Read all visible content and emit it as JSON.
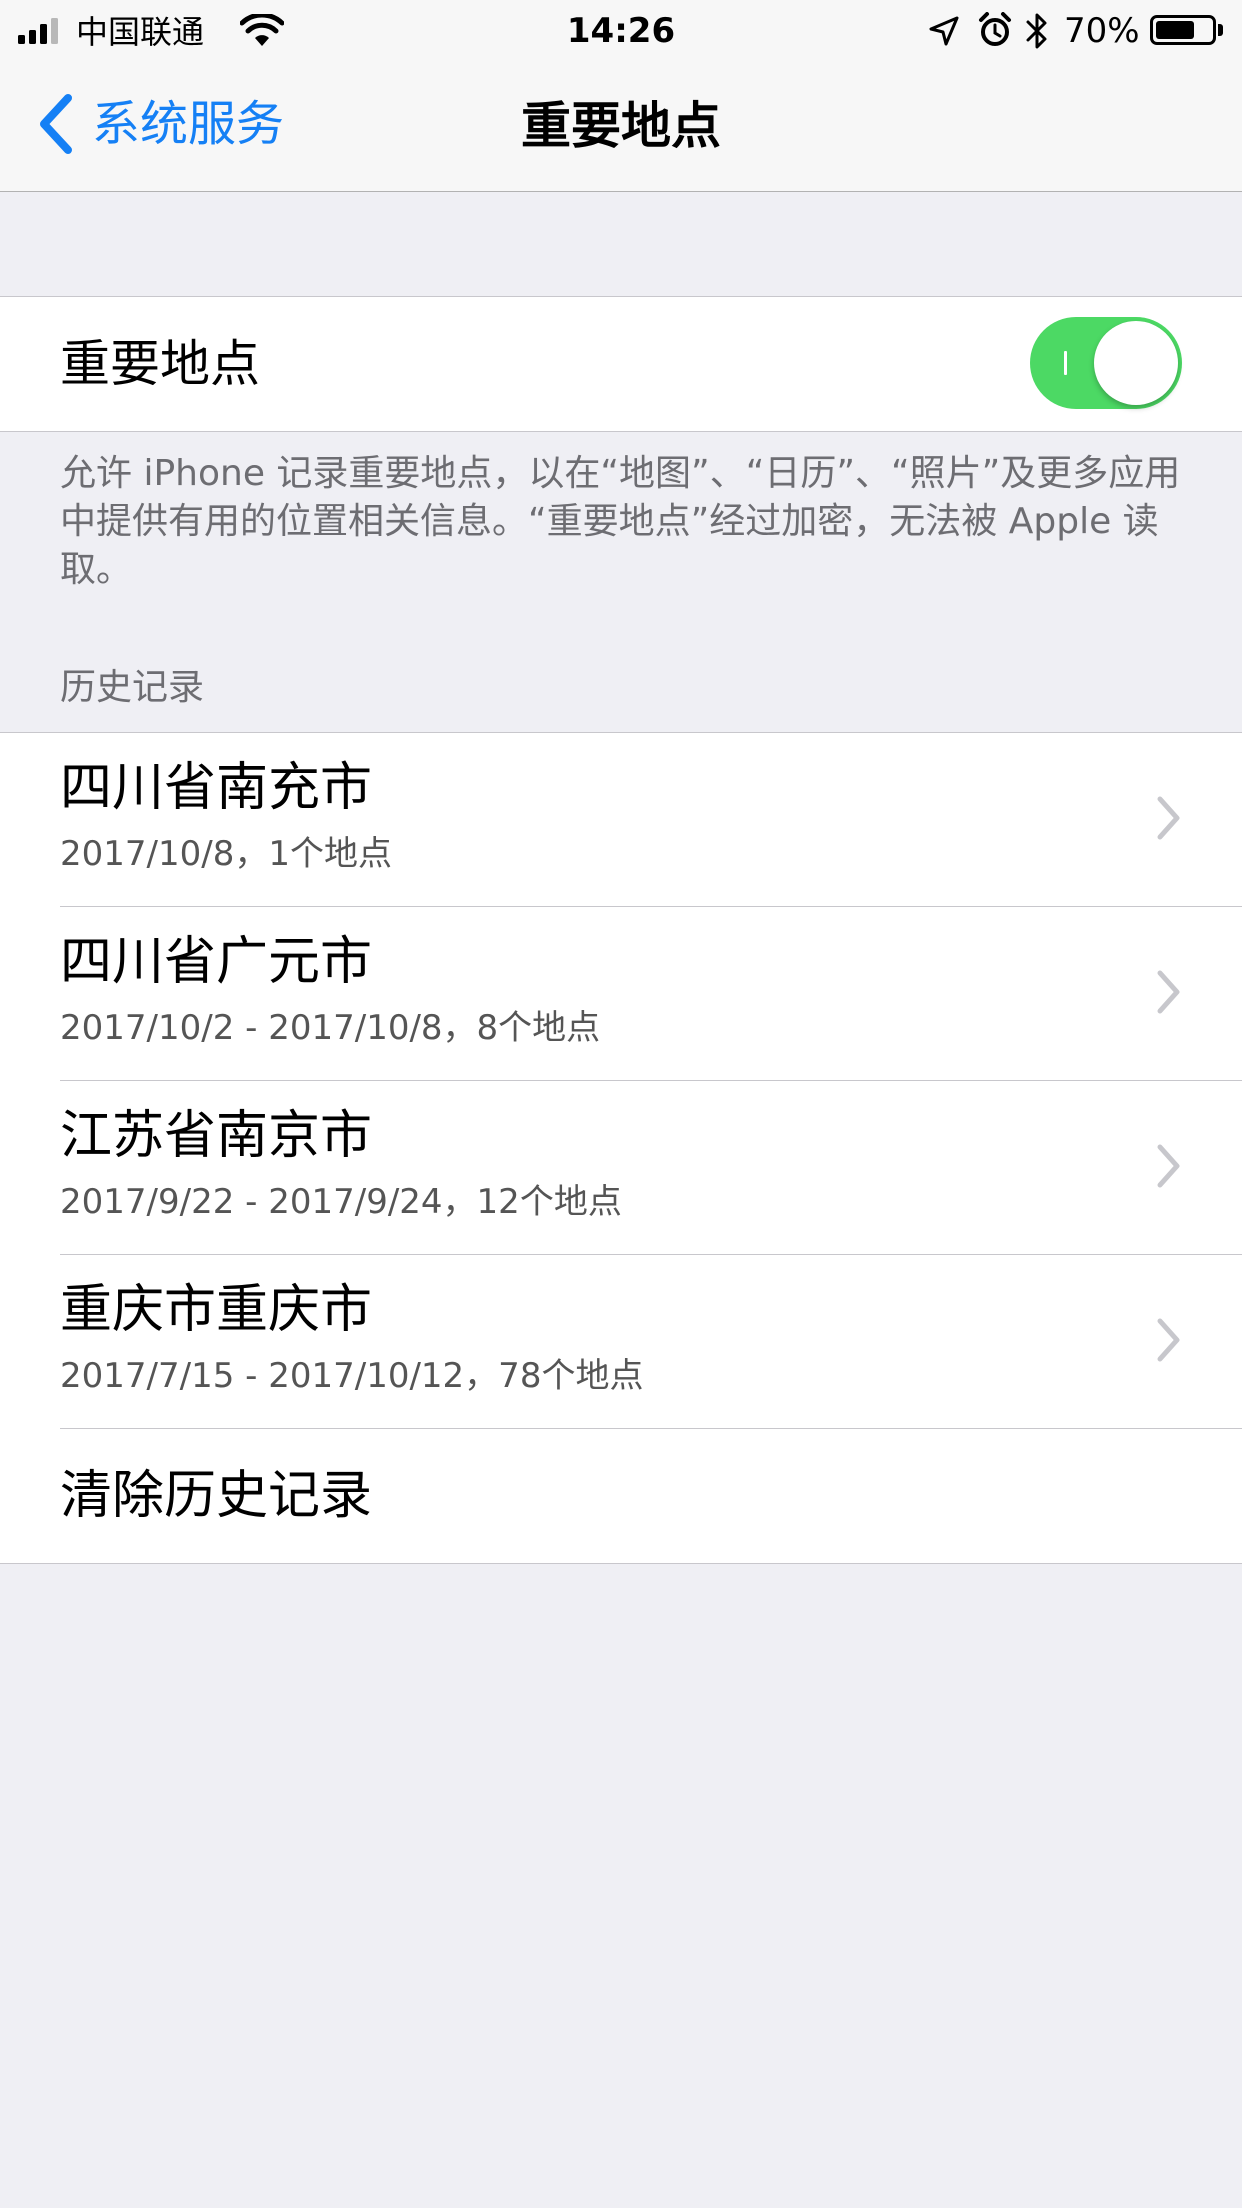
{
  "status_bar": {
    "carrier": "中国联通",
    "time": "14:26",
    "battery_percent": "70%",
    "battery_level": 0.7,
    "signal_bars_filled": 3,
    "signal_bars_total": 4,
    "icons": [
      "signal-icon",
      "wifi-icon",
      "location-arrow-icon",
      "alarm-icon",
      "bluetooth-icon",
      "battery-icon"
    ]
  },
  "nav": {
    "back_label": "系统服务",
    "title": "重要地点"
  },
  "toggle": {
    "label": "重要地点",
    "on": true,
    "on_color": "#4cd964"
  },
  "description": "允许 iPhone 记录重要地点，以在“地图”、“日历”、“照片”及更多应用中提供有用的位置相关信息。“重要地点”经过加密，无法被 Apple 读取。",
  "history": {
    "header": "历史记录",
    "items": [
      {
        "title": "四川省南充市",
        "subtitle": "2017/10/8，1个地点"
      },
      {
        "title": "四川省广元市",
        "subtitle": "2017/10/2 - 2017/10/8，8个地点"
      },
      {
        "title": "江苏省南京市",
        "subtitle": "2017/9/22 - 2017/9/24，12个地点"
      },
      {
        "title": "重庆市重庆市",
        "subtitle": "2017/7/15 - 2017/10/12，78个地点"
      }
    ],
    "clear_label": "清除历史记录"
  },
  "colors": {
    "tint": "#1580f5",
    "background": "#efeff4",
    "secondary_text": "#6d6d72",
    "separator": "#c8c7cc"
  }
}
